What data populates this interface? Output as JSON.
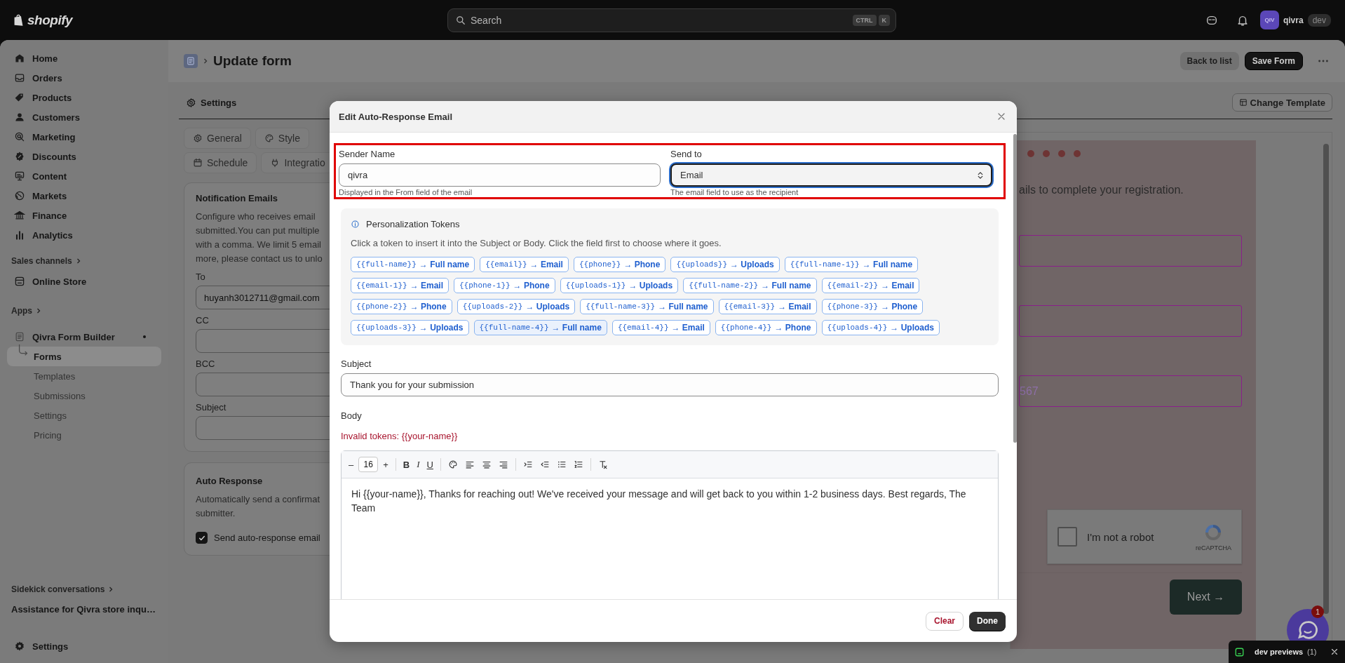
{
  "topbar": {
    "logo": "shopify",
    "search": {
      "placeholder": "Search"
    },
    "shortcut": [
      "CTRL",
      "K"
    ],
    "avatar": "QIV",
    "user": "qivra",
    "badge": "dev"
  },
  "sidebar": {
    "items": [
      {
        "label": "Home",
        "selected": false
      },
      {
        "label": "Orders",
        "selected": false
      },
      {
        "label": "Products",
        "selected": false
      },
      {
        "label": "Customers",
        "selected": false
      },
      {
        "label": "Marketing",
        "selected": false
      },
      {
        "label": "Discounts",
        "selected": false
      },
      {
        "label": "Content",
        "selected": false
      },
      {
        "label": "Markets",
        "selected": false
      },
      {
        "label": "Finance",
        "selected": false
      },
      {
        "label": "Analytics",
        "selected": false
      }
    ],
    "sales_channels": "Sales channels",
    "channels": [
      {
        "label": "Online Store",
        "selected": false
      }
    ],
    "apps_heading": "Apps",
    "app": {
      "label": "Qivra Form Builder"
    },
    "app_items": [
      {
        "label": "Forms",
        "selected": true
      },
      {
        "label": "Templates",
        "selected": false
      },
      {
        "label": "Submissions",
        "selected": false
      },
      {
        "label": "Settings",
        "selected": false
      },
      {
        "label": "Pricing",
        "selected": false
      }
    ],
    "sidekick": "Sidekick conversations",
    "conversations": [
      "Assistance for Qivra store inqu…"
    ],
    "settings": "Settings"
  },
  "page": {
    "title": "Update form",
    "buttons": [
      {
        "label": "Back to list",
        "kind": "secondary"
      },
      {
        "label": "Save Form",
        "kind": "primary"
      }
    ]
  },
  "settings_panel": {
    "tab": "Settings",
    "subtabs": [
      [
        "General",
        "Style"
      ],
      [
        "Schedule",
        "Integratio"
      ]
    ],
    "notification": {
      "title": "Notification Emails",
      "description": [
        "Configure who receives email",
        "submitted.You can put multiple",
        "with a comma. We limit 5 email",
        "more, please contact us to unlo"
      ],
      "fields": [
        {
          "label": "To",
          "value": "huyanh3012711@gmail.com"
        },
        {
          "label": "CC"
        },
        {
          "label": "BCC"
        },
        {
          "label": "Subject"
        }
      ]
    },
    "auto_response": {
      "title": "Auto Response",
      "description": [
        "Automatically send a confirmat",
        "submitter."
      ],
      "checkbox": {
        "label": "Send auto-response email",
        "checked": true
      }
    }
  },
  "preview": {
    "change_template": "Change Template",
    "text": "ails to complete your registration.",
    "field_3": {
      "placeholder": "567"
    },
    "captcha": {
      "label": "I'm not a robot",
      "brand": "reCAPTCHA",
      "checked": false
    },
    "next": "Next →"
  },
  "modal": {
    "title": "Edit Auto-Response Email",
    "sender": {
      "label": "Sender Name",
      "value": "qivra",
      "help": "Displayed in the From field of the email"
    },
    "send_to": {
      "label": "Send to",
      "value": "Email",
      "help": "The email field to use as the recipient",
      "focused": true
    },
    "tokens": {
      "title": "Personalization Tokens",
      "description": "Click a token to insert it into the Subject or Body. Click the field first to choose where it goes.",
      "items": [
        {
          "token": "{{full-name}}",
          "label": "→ Full name",
          "hovered": false
        },
        {
          "token": "{{email}}",
          "label": "→ Email",
          "hovered": false
        },
        {
          "token": "{{phone}}",
          "label": "→ Phone",
          "hovered": false
        },
        {
          "token": "{{uploads}}",
          "label": "→ Uploads",
          "hovered": false
        },
        {
          "token": "{{full-name-1}}",
          "label": "→ Full name",
          "hovered": false
        },
        {
          "token": "{{email-1}}",
          "label": "→ Email",
          "hovered": false
        },
        {
          "token": "{{phone-1}}",
          "label": "→ Phone",
          "hovered": false
        },
        {
          "token": "{{uploads-1}}",
          "label": "→ Uploads",
          "hovered": false
        },
        {
          "token": "{{full-name-2}}",
          "label": "→ Full name",
          "hovered": false
        },
        {
          "token": "{{email-2}}",
          "label": "→ Email",
          "hovered": false
        },
        {
          "token": "{{phone-2}}",
          "label": "→ Phone",
          "hovered": false
        },
        {
          "token": "{{uploads-2}}",
          "label": "→ Uploads",
          "hovered": false
        },
        {
          "token": "{{full-name-3}}",
          "label": "→ Full name",
          "hovered": false
        },
        {
          "token": "{{email-3}}",
          "label": "→ Email",
          "hovered": false
        },
        {
          "token": "{{phone-3}}",
          "label": "→ Phone",
          "hovered": false
        },
        {
          "token": "{{uploads-3}}",
          "label": "→ Uploads",
          "hovered": false
        },
        {
          "token": "{{full-name-4}}",
          "label": "→ Full name",
          "hovered": true
        },
        {
          "token": "{{email-4}}",
          "label": "→ Email",
          "hovered": false
        },
        {
          "token": "{{phone-4}}",
          "label": "→ Phone",
          "hovered": false
        },
        {
          "token": "{{uploads-4}}",
          "label": "→ Uploads",
          "hovered": false
        }
      ]
    },
    "subject": {
      "label": "Subject",
      "value": "Thank you for your submission"
    },
    "body": {
      "label": "Body",
      "error": "Invalid tokens: {{your-name}}",
      "toolbar": {
        "decrease": "–",
        "size": "16",
        "increase": "+",
        "bold": "B",
        "italic": "I",
        "underline": "U"
      },
      "text": "Hi {{your-name}}, Thanks for reaching out! We've received your message and will get back to you within 1-2 business days. Best regards, The Team"
    },
    "buttons": [
      {
        "label": "Clear",
        "kind": "danger"
      },
      {
        "label": "Done",
        "kind": "primary"
      }
    ]
  },
  "chat": {
    "badge": "1"
  },
  "dev_bar": {
    "label": "dev previews",
    "count": "(1)"
  }
}
